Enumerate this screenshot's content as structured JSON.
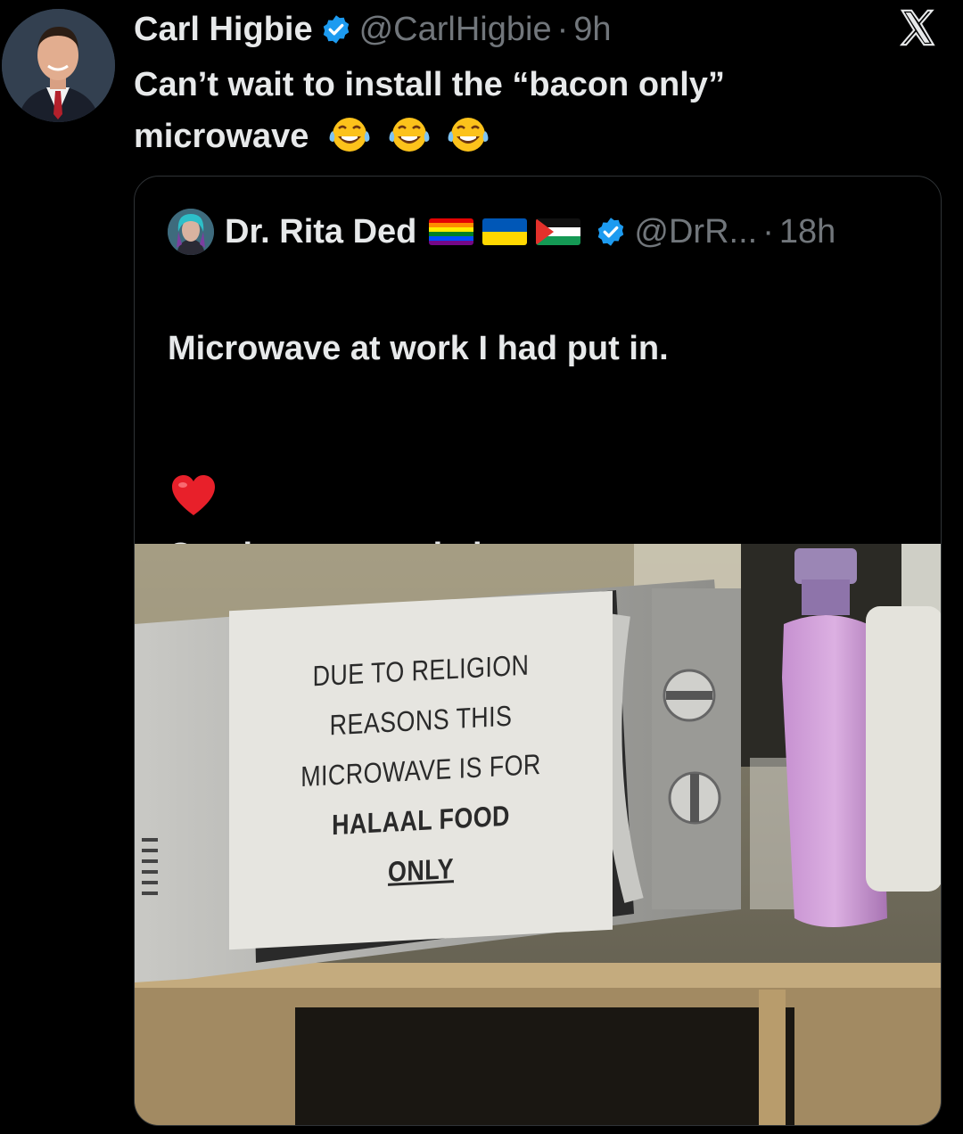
{
  "author": {
    "name": "Carl Higbie",
    "handle": "@CarlHigbie",
    "time": "9h",
    "separator": "·"
  },
  "brand_icon": "x-logo-icon",
  "tweet": {
    "line1": "Can’t wait to install the “bacon only”",
    "line2": "microwave"
  },
  "quoted": {
    "name": "Dr. Rita Ded",
    "handle": "@DrR...",
    "time": "18h",
    "separator": "·",
    "line1": "Microwave at work I had put in.",
    "line2": "Coming to a workplace near you."
  },
  "sign": {
    "line1": "DUE TO RELIGION",
    "line2": "REASONS THIS",
    "line3": "MICROWAVE IS FOR",
    "line4": "HALAAL FOOD",
    "line5": "ONLY"
  },
  "colors": {
    "background": "#000000",
    "text": "#e7e9ea",
    "muted": "#71767b",
    "verified": "#1d9bf0"
  }
}
